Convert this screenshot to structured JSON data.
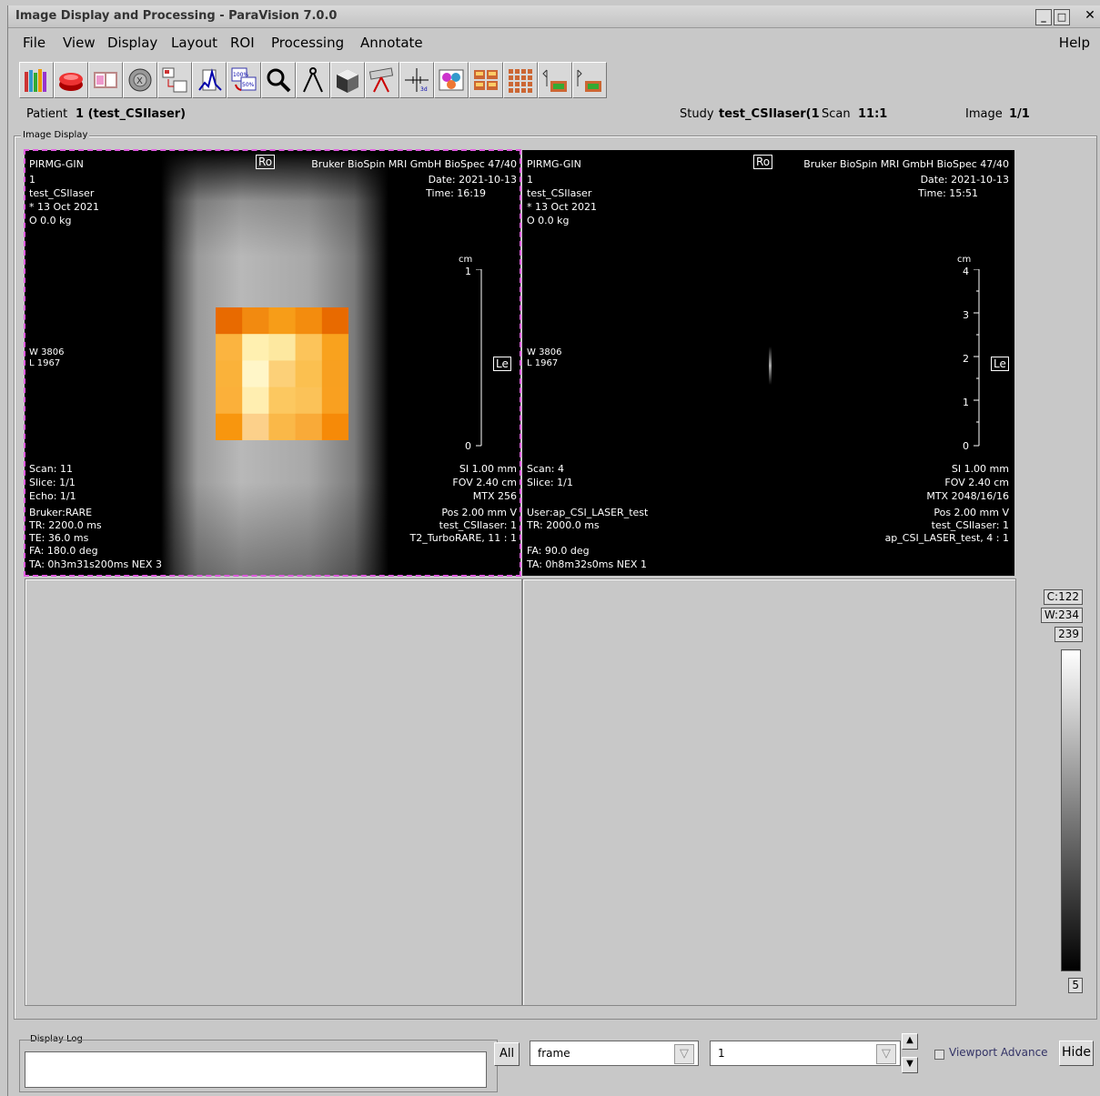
{
  "window": {
    "title": "Image Display and Processing - ParaVision 7.0.0",
    "controls": [
      "_",
      "□",
      "✕"
    ]
  },
  "menu": {
    "file": "File",
    "view": "View",
    "display": "Display",
    "layout": "Layout",
    "roi": "ROI",
    "processing": "Processing",
    "annotate": "Annotate",
    "help": "Help"
  },
  "toolbar": {
    "icons": [
      "library-icon",
      "database-icon",
      "book-icon",
      "sphere-icon",
      "layout-icon",
      "spectrum-icon",
      "zoom-percent-icon",
      "magnifier-icon",
      "calipers-icon",
      "cube-icon",
      "telescope-icon",
      "crosshair-icon",
      "palette-icon",
      "grid-small-icon",
      "grid-large-icon",
      "prev-image-icon",
      "next-image-icon"
    ]
  },
  "info": {
    "patient_label": "Patient",
    "patient_value": "1 (test_CSIlaser)",
    "study_label": "Study",
    "study_value": "test_CSIlaser(1",
    "scan_label": "Scan",
    "scan_value": "11:1",
    "image_label": "Image",
    "image_value": "1/1"
  },
  "group_label": "Image Display",
  "viewport1": {
    "tl1": "PIRMG-GIN",
    "tl2": "1",
    "tl3": "test_CSIlaser",
    "tl4": "* 13 Oct 2021",
    "tl5": "O 0.0 kg",
    "orient_top": "Ro",
    "tr1": "Bruker BioSpin MRI GmbH BioSpec 47/40",
    "tr2": "Date: 2021-10-13",
    "tr3": "Time: 16:19",
    "wl1": "W 3806",
    "wl2": "L 1967",
    "scale_unit": "cm",
    "scale_top": "1",
    "scale_bottom": "0",
    "orient_side": "Le",
    "bl1": "Scan: 11",
    "bl2": "Slice: 1/1",
    "bl3": "Echo: 1/1",
    "bl4": "Bruker:RARE",
    "bl5": "TR: 2200.0 ms",
    "bl6": "TE: 36.0 ms",
    "bl7": "FA: 180.0 deg",
    "bl8": "TA: 0h3m31s200ms NEX 3",
    "br1": "SI 1.00 mm",
    "br2": "FOV 2.40 cm",
    "br3": "MTX 256",
    "br4": "Pos 2.00 mm V",
    "br5": "test_CSIlaser: 1",
    "br6": "T2_TurboRARE, 11 : 1"
  },
  "viewport2": {
    "tl1": "PIRMG-GIN",
    "tl2": "1",
    "tl3": "test_CSIlaser",
    "tl4": "* 13 Oct 2021",
    "tl5": "O 0.0 kg",
    "orient_top": "Ro",
    "tr1": "Bruker BioSpin MRI GmbH BioSpec 47/40",
    "tr2": "Date: 2021-10-13",
    "tr3": "Time: 15:51",
    "wl1": "W 3806",
    "wl2": "L 1967",
    "scale_unit": "cm",
    "scale_4": "4",
    "scale_3": "3",
    "scale_2": "2",
    "scale_1": "1",
    "scale_0": "0",
    "orient_side": "Le",
    "bl1": "Scan: 4",
    "bl2": "Slice: 1/1",
    "bl3": "User:ap_CSI_LASER_test",
    "bl4": "TR: 2000.0 ms",
    "bl5": "FA: 90.0 deg",
    "bl6": "TA: 0h8m32s0ms NEX 1",
    "br1": "SI 1.00 mm",
    "br2": "FOV 2.40 cm",
    "br3": "MTX 2048/16/16",
    "br4": "Pos 2.00 mm V",
    "br5": "test_CSIlaser: 1",
    "br6": "ap_CSI_LASER_test, 4 : 1"
  },
  "colorbar": {
    "center": "C:122",
    "width": "W:234",
    "max": "239",
    "min": "5"
  },
  "csi_grid": [
    [
      "#e86a00",
      "#f28a10",
      "#f79d18",
      "#f38c0e",
      "#e86a00"
    ],
    [
      "#fbb440",
      "#fff0b0",
      "#fde8a0",
      "#fcc45a",
      "#f9a21e"
    ],
    [
      "#fab23a",
      "#fff6c8",
      "#fcd078",
      "#fbc050",
      "#f8a020"
    ],
    [
      "#fbb03a",
      "#ffeeb0",
      "#fcc860",
      "#fbc258",
      "#f9a020"
    ],
    [
      "#f8960e",
      "#fcd08a",
      "#fab848",
      "#f9aa38",
      "#f68a08"
    ]
  ],
  "bottom": {
    "log_label": "Display Log",
    "all": "All",
    "frame": "frame",
    "frame_value": "1",
    "viewport_advance": "Viewport Advance",
    "hide": "Hide"
  }
}
